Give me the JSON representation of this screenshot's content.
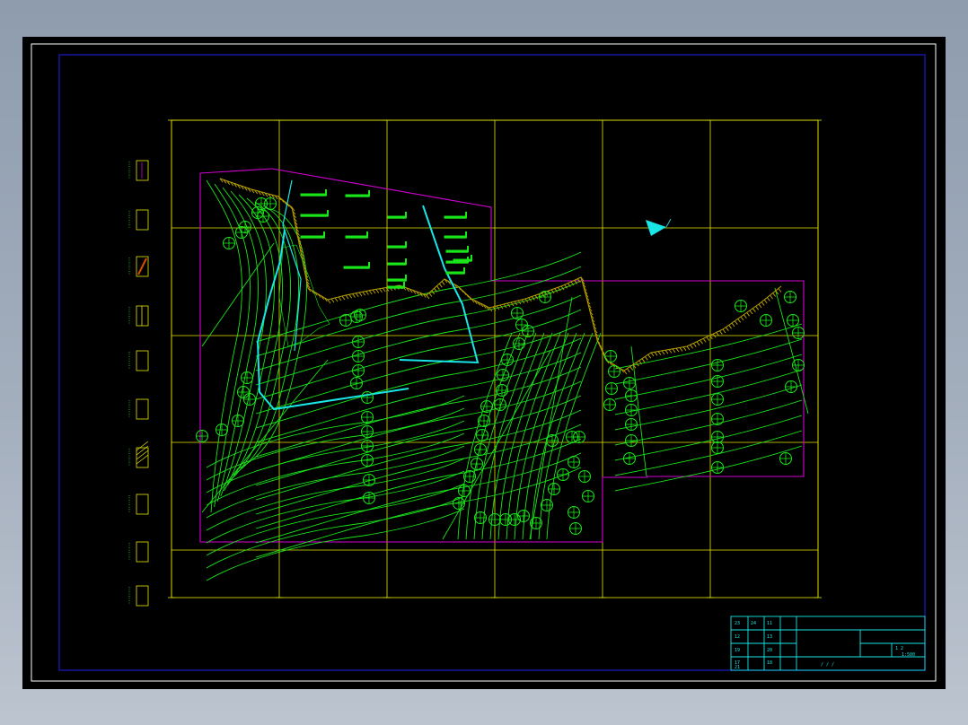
{
  "drawing": {
    "title_block_scale": "1:500",
    "title_block_sheet": "1 2",
    "title_block_note": "/ / /",
    "title_block_cells": [
      "23",
      "24",
      "11",
      "12",
      "13",
      "19",
      "20",
      "17",
      "18",
      "21"
    ]
  },
  "colors": {
    "frame": "#ffffff",
    "inner_frame": "#1a1acc",
    "grid": "#e6e600",
    "boundary": "#d400d4",
    "contour": "#19e619",
    "water": "#19e6e6",
    "hatch": "#b8a000",
    "title_block": "#19e6e6"
  },
  "legend": {
    "items": [
      "symbol-cross",
      "symbol-line",
      "symbol-hatch",
      "symbol-grid",
      "symbol-box",
      "symbol-bar",
      "symbol-diag",
      "symbol-double",
      "symbol-step",
      "symbol-rect"
    ]
  },
  "north_arrow": {
    "icon": "north-arrow-icon"
  }
}
